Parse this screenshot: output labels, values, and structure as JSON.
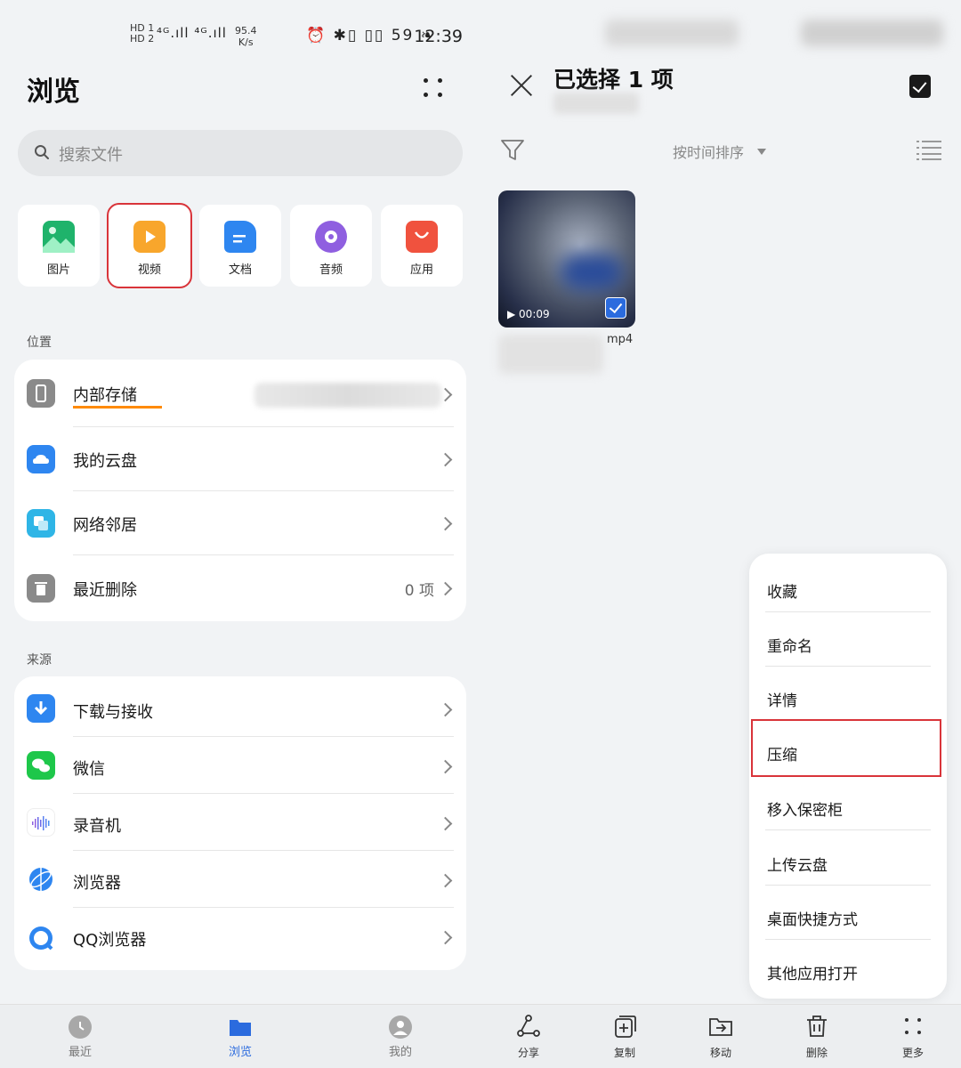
{
  "status_bar": {
    "hd_top": "HD 1",
    "hd_bottom": "HD 2",
    "signal": "⁴ᴳ.ıll ⁴ᴳ.ıll",
    "net_speed": "95.4",
    "net_unit": "K/s",
    "icons": "⏰ ✱▯ ▯▯ 59 ❧",
    "time": "12:39"
  },
  "left": {
    "title": "浏览",
    "search_placeholder": "搜索文件",
    "categories": [
      {
        "label": "图片",
        "icon": "image-icon",
        "color": "#1fb36b"
      },
      {
        "label": "视频",
        "icon": "video-icon",
        "color": "#f8a62c"
      },
      {
        "label": "文档",
        "icon": "document-icon",
        "color": "#2e86f0"
      },
      {
        "label": "音频",
        "icon": "audio-icon",
        "color": "#8f5fe0"
      },
      {
        "label": "应用",
        "icon": "app-icon",
        "color": "#f0523e"
      }
    ],
    "location_label": "位置",
    "locations": [
      {
        "label": "内部存储",
        "icon": "phone-icon",
        "color": "#8a8a8a"
      },
      {
        "label": "我的云盘",
        "icon": "cloud-icon",
        "color": "#2e86f0"
      },
      {
        "label": "网络邻居",
        "icon": "network-icon",
        "color": "#2fb5e6"
      },
      {
        "label": "最近删除",
        "icon": "trash-icon",
        "color": "#8a8a8a",
        "value": "0 项"
      }
    ],
    "source_label": "来源",
    "sources": [
      {
        "label": "下载与接收",
        "icon": "download-icon",
        "color": "#2e86f0"
      },
      {
        "label": "微信",
        "icon": "wechat-icon",
        "color": "#1ec74a"
      },
      {
        "label": "录音机",
        "icon": "recorder-icon",
        "color": "#ffffff"
      },
      {
        "label": "浏览器",
        "icon": "browser-icon",
        "color": "#2e86f0"
      },
      {
        "label": "QQ浏览器",
        "icon": "qq-browser-icon",
        "color": "#2e86f0"
      }
    ],
    "nav": [
      {
        "label": "最近",
        "icon": "clock-icon"
      },
      {
        "label": "浏览",
        "icon": "folder-icon",
        "active": true
      },
      {
        "label": "我的",
        "icon": "user-icon"
      }
    ]
  },
  "right": {
    "selection_title": "已选择 1 项",
    "sort_label": "按时间排序",
    "video_duration": "00:09",
    "file_ext": "mp4",
    "menu": [
      "收藏",
      "重命名",
      "详情",
      "压缩",
      "移入保密柜",
      "上传云盘",
      "桌面快捷方式",
      "其他应用打开"
    ],
    "actions": [
      {
        "label": "分享",
        "icon": "share-icon"
      },
      {
        "label": "复制",
        "icon": "copy-icon"
      },
      {
        "label": "移动",
        "icon": "move-icon"
      },
      {
        "label": "删除",
        "icon": "delete-icon"
      },
      {
        "label": "更多",
        "icon": "more-icon"
      }
    ]
  }
}
